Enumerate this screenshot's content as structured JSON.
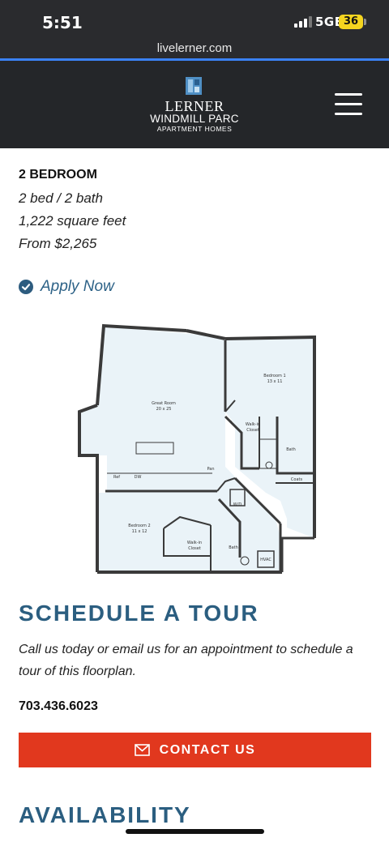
{
  "status_bar": {
    "time": "5:51",
    "network": "5GE",
    "battery": "36"
  },
  "browser": {
    "url": "livelerner.com"
  },
  "header": {
    "brand": "LERNER",
    "property": "WINDMILL PARC",
    "tagline": "APARTMENT HOMES",
    "icons": {
      "logo": "lerner-logo-icon",
      "menu": "hamburger-menu-icon"
    }
  },
  "plan": {
    "name": "2 BEDROOM",
    "beds_baths": "2 bed / 2 bath",
    "area": "1,222 square feet",
    "price": "From $2,265",
    "apply_label": "Apply Now",
    "apply_icon": "check-circle-icon"
  },
  "floorplan_labels": {
    "great_room": "Great Room",
    "great_room_size": "20 x 25",
    "bedroom1": "Bedroom 1",
    "bedroom1_size": "13 x 11",
    "bedroom2": "Bedroom 2",
    "bedroom2_size": "11 x 12",
    "walk_in_a": "Walk-in",
    "closet_a": "Closet",
    "walk_in_b": "Walk-in",
    "closet_b": "Closet",
    "bath1": "Bath",
    "bath2": "Bath",
    "coats": "Coats",
    "pan": "Pan",
    "wd": "W/D",
    "hvac": "HVAC",
    "ref": "Ref",
    "dw": "DW",
    "linen": "L"
  },
  "tour": {
    "title": "SCHEDULE A TOUR",
    "description": "Call us today or email us for an appointment to schedule a tour of this floorplan.",
    "phone": "703.436.6023",
    "contact_label": "CONTACT US",
    "contact_icon": "mail-icon"
  },
  "availability": {
    "title": "AVAILABILITY"
  },
  "colors": {
    "header_bg": "#242629",
    "accent_blue": "#2b5e80",
    "cta_red": "#e1381e",
    "floor_fill": "#eaf3f8"
  }
}
